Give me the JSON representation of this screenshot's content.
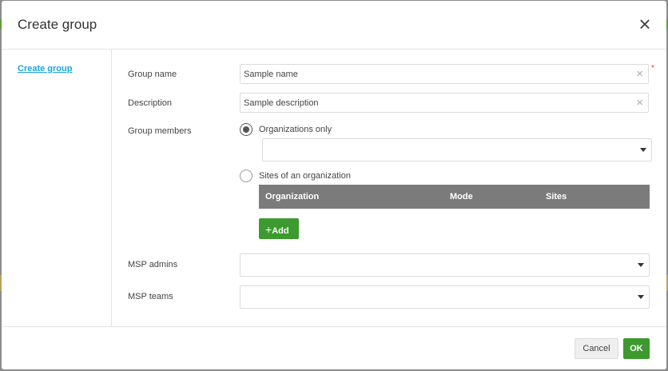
{
  "colors": {
    "accent_green": "#3d9a2e",
    "link_blue": "#1aa4dc",
    "table_header": "#7b7b7b",
    "required_red": "#ee3333"
  },
  "modal": {
    "title": "Create group",
    "close_icon": "close-icon"
  },
  "sidebar": {
    "items": [
      {
        "label": "Create group",
        "active": true
      }
    ]
  },
  "form": {
    "group_name": {
      "label": "Group name",
      "value": "Sample name",
      "required_mark": "*"
    },
    "description": {
      "label": "Description",
      "value": "Sample description"
    },
    "group_members": {
      "label": "Group members",
      "option_orgs": {
        "label": "Organizations only",
        "checked": true
      },
      "orgs_select_value": "",
      "option_sites": {
        "label": "Sites of an organization",
        "checked": false
      },
      "table_columns": [
        "Organization",
        "Mode",
        "Sites"
      ],
      "add_button": {
        "icon": "+",
        "label": "Add"
      }
    },
    "msp_admins": {
      "label": "MSP admins",
      "value": ""
    },
    "msp_teams": {
      "label": "MSP teams",
      "value": ""
    }
  },
  "footer": {
    "cancel_label": "Cancel",
    "ok_label": "OK"
  }
}
